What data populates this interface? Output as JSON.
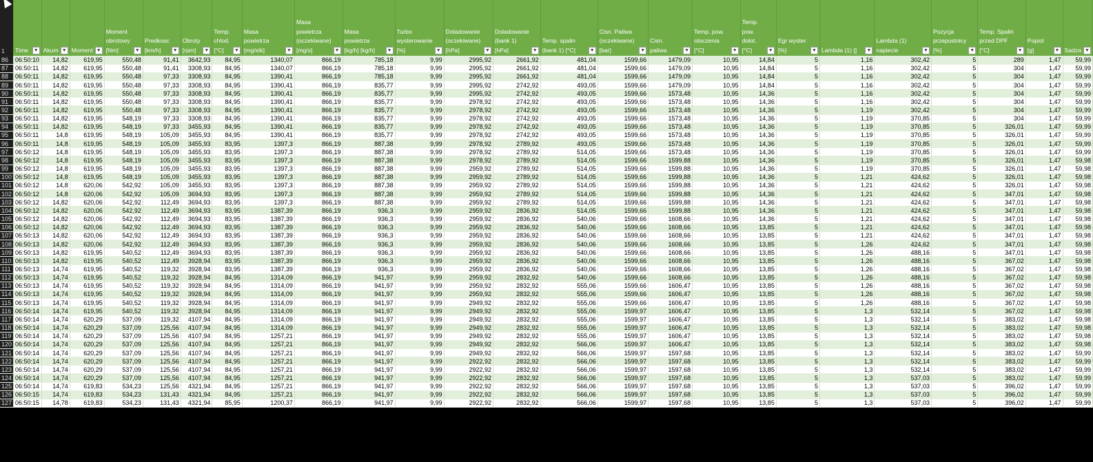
{
  "header_row_number": "1",
  "columns": [
    {
      "label": "Time",
      "w": 41
    },
    {
      "label": "Akum",
      "w": 30
    },
    {
      "label": "Moment",
      "w": 44
    },
    {
      "label": "Moment obrotowy [Nm]",
      "w": 57
    },
    {
      "label": "Predkosc [km/h]",
      "w": 54
    },
    {
      "label": "Obroty [rpm]",
      "w": 46
    },
    {
      "label": "Temp. chlod. [°C]",
      "w": 44
    },
    {
      "label": "Masa powietrza [mg/stk]",
      "w": 84
    },
    {
      "label": "Masa powietrza (oczekiwane) [mg/s]",
      "w": 42
    },
    {
      "label": "Masa powietrza [kg/h] [kg/h]",
      "w": 84
    },
    {
      "label": "Turbo wysterowanie [%]",
      "w": 45
    },
    {
      "label": "Doladowanie (oczekiwane) [hPa]",
      "w": 72
    },
    {
      "label": "Doladowanie (bank 1) [hPa]",
      "w": 44
    },
    {
      "label": "Temp. spalin (bank 1) [°C]",
      "w": 99
    },
    {
      "label": "Cisn. Paliwa (oczekiwane) [bar]",
      "w": 75
    },
    {
      "label": "Cisn. paliwa",
      "w": 72
    },
    {
      "label": "Temp. pow. otoczenia [°C]",
      "w": 75
    },
    {
      "label": "Temp. pow. dolot. [°C]",
      "w": 56
    },
    {
      "label": "Egr wyster. [%]",
      "w": 70
    },
    {
      "label": "Lambda (1) []",
      "w": 91
    },
    {
      "label": "Lambda (1) napiecie",
      "w": 95
    },
    {
      "label": "Pozycja przepustnicy [%]",
      "w": 43
    },
    {
      "label": "Temp. Spalin przed DPF [°C]",
      "w": 80
    },
    {
      "label": "Popiol [g]",
      "w": 58
    },
    {
      "label": "Sadza",
      "w": 36
    }
  ],
  "rows": [
    [
      "86",
      "06:50:10",
      "14,82",
      "619,95",
      "550,48",
      "91,41",
      "3642,93",
      "84,95",
      "1340,07",
      "866,19",
      "785,18",
      "9,99",
      "2995,92",
      "2661,92",
      "481,04",
      "1599,66",
      "1479,09",
      "10,95",
      "14,84",
      "5",
      "1,16",
      "302,42",
      "5",
      "289",
      "1,47",
      "59,99"
    ],
    [
      "87",
      "06:50:11",
      "14,82",
      "619,95",
      "550,48",
      "91,41",
      "3308,93",
      "84,95",
      "1340,07",
      "866,19",
      "785,18",
      "9,99",
      "2995,92",
      "2661,92",
      "481,04",
      "1599,66",
      "1479,09",
      "10,95",
      "14,84",
      "5",
      "1,16",
      "302,42",
      "5",
      "304",
      "1,47",
      "59,99"
    ],
    [
      "88",
      "06:50:11",
      "14,82",
      "619,95",
      "550,48",
      "97,33",
      "3308,93",
      "84,95",
      "1390,41",
      "866,19",
      "785,18",
      "9,99",
      "2995,92",
      "2661,92",
      "481,04",
      "1599,66",
      "1479,09",
      "10,95",
      "14,84",
      "5",
      "1,16",
      "302,42",
      "5",
      "304",
      "1,47",
      "59,99"
    ],
    [
      "89",
      "06:50:11",
      "14,82",
      "619,95",
      "550,48",
      "97,33",
      "3308,93",
      "84,95",
      "1390,41",
      "866,19",
      "835,77",
      "9,99",
      "2995,92",
      "2742,92",
      "493,05",
      "1599,66",
      "1479,09",
      "10,95",
      "14,84",
      "5",
      "1,16",
      "302,42",
      "5",
      "304",
      "1,47",
      "59,99"
    ],
    [
      "90",
      "06:50:11",
      "14,82",
      "619,95",
      "550,48",
      "97,33",
      "3308,93",
      "84,95",
      "1390,41",
      "866,19",
      "835,77",
      "9,99",
      "2995,92",
      "2742,92",
      "493,05",
      "1599,66",
      "1573,48",
      "10,95",
      "14,36",
      "5",
      "1,16",
      "302,42",
      "5",
      "304",
      "1,47",
      "59,99"
    ],
    [
      "91",
      "06:50:11",
      "14,82",
      "619,95",
      "550,48",
      "97,33",
      "3308,93",
      "84,95",
      "1390,41",
      "866,19",
      "835,77",
      "9,99",
      "2978,92",
      "2742,92",
      "493,05",
      "1599,66",
      "1573,48",
      "10,95",
      "14,36",
      "5",
      "1,16",
      "302,42",
      "5",
      "304",
      "1,47",
      "59,99"
    ],
    [
      "92",
      "06:50:11",
      "14,82",
      "619,95",
      "550,48",
      "97,33",
      "3308,93",
      "84,95",
      "1390,41",
      "866,19",
      "835,77",
      "9,99",
      "2978,92",
      "2742,92",
      "493,05",
      "1599,66",
      "1573,48",
      "10,95",
      "14,36",
      "5",
      "1,19",
      "302,42",
      "5",
      "304",
      "1,47",
      "59,99"
    ],
    [
      "93",
      "06:50:11",
      "14,82",
      "619,95",
      "548,19",
      "97,33",
      "3308,93",
      "84,95",
      "1390,41",
      "866,19",
      "835,77",
      "9,99",
      "2978,92",
      "2742,92",
      "493,05",
      "1599,66",
      "1573,48",
      "10,95",
      "14,36",
      "5",
      "1,19",
      "370,85",
      "5",
      "304",
      "1,47",
      "59,99"
    ],
    [
      "94",
      "06:50:11",
      "14,82",
      "619,95",
      "548,19",
      "97,33",
      "3455,93",
      "84,95",
      "1390,41",
      "866,19",
      "835,77",
      "9,99",
      "2978,92",
      "2742,92",
      "493,05",
      "1599,66",
      "1573,48",
      "10,95",
      "14,36",
      "5",
      "1,19",
      "370,85",
      "5",
      "326,01",
      "1,47",
      "59,99"
    ],
    [
      "95",
      "06:50:11",
      "14,8",
      "619,95",
      "548,19",
      "105,09",
      "3455,93",
      "84,95",
      "1390,41",
      "866,19",
      "835,77",
      "9,99",
      "2978,92",
      "2742,92",
      "493,05",
      "1599,66",
      "1573,48",
      "10,95",
      "14,36",
      "5",
      "1,19",
      "370,85",
      "5",
      "326,01",
      "1,47",
      "59,99"
    ],
    [
      "96",
      "06:50:11",
      "14,8",
      "619,95",
      "548,19",
      "105,09",
      "3455,93",
      "83,95",
      "1397,3",
      "866,19",
      "887,38",
      "9,99",
      "2978,92",
      "2789,92",
      "493,05",
      "1599,66",
      "1573,48",
      "10,95",
      "14,36",
      "5",
      "1,19",
      "370,85",
      "5",
      "326,01",
      "1,47",
      "59,99"
    ],
    [
      "97",
      "06:50:12",
      "14,8",
      "619,95",
      "548,19",
      "105,09",
      "3455,93",
      "83,95",
      "1397,3",
      "866,19",
      "887,38",
      "9,99",
      "2978,92",
      "2789,92",
      "514,05",
      "1599,66",
      "1573,48",
      "10,95",
      "14,36",
      "5",
      "1,19",
      "370,85",
      "5",
      "326,01",
      "1,47",
      "59,99"
    ],
    [
      "98",
      "06:50:12",
      "14,8",
      "619,95",
      "548,19",
      "105,09",
      "3455,93",
      "83,95",
      "1397,3",
      "866,19",
      "887,38",
      "9,99",
      "2978,92",
      "2789,92",
      "514,05",
      "1599,66",
      "1599,88",
      "10,95",
      "14,36",
      "5",
      "1,19",
      "370,85",
      "5",
      "326,01",
      "1,47",
      "59,98"
    ],
    [
      "99",
      "06:50:12",
      "14,8",
      "619,95",
      "548,19",
      "105,09",
      "3455,93",
      "83,95",
      "1397,3",
      "866,19",
      "887,38",
      "9,99",
      "2959,92",
      "2789,92",
      "514,05",
      "1599,66",
      "1599,88",
      "10,95",
      "14,36",
      "5",
      "1,19",
      "370,85",
      "5",
      "326,01",
      "1,47",
      "59,98"
    ],
    [
      "100",
      "06:50:12",
      "14,8",
      "619,95",
      "548,19",
      "105,09",
      "3455,93",
      "83,95",
      "1397,3",
      "866,19",
      "887,38",
      "9,99",
      "2959,92",
      "2789,92",
      "514,05",
      "1599,66",
      "1599,88",
      "10,95",
      "14,36",
      "5",
      "1,21",
      "424,62",
      "5",
      "326,01",
      "1,47",
      "59,98"
    ],
    [
      "101",
      "06:50:12",
      "14,8",
      "620,06",
      "542,92",
      "105,09",
      "3455,93",
      "83,95",
      "1397,3",
      "866,19",
      "887,38",
      "9,99",
      "2959,92",
      "2789,92",
      "514,05",
      "1599,66",
      "1599,88",
      "10,95",
      "14,36",
      "5",
      "1,21",
      "424,62",
      "5",
      "326,01",
      "1,47",
      "59,98"
    ],
    [
      "102",
      "06:50:12",
      "14,8",
      "620,06",
      "542,92",
      "105,09",
      "3694,93",
      "83,95",
      "1397,3",
      "866,19",
      "887,38",
      "9,99",
      "2959,92",
      "2789,92",
      "514,05",
      "1599,66",
      "1599,88",
      "10,95",
      "14,36",
      "5",
      "1,21",
      "424,62",
      "5",
      "347,01",
      "1,47",
      "59,98"
    ],
    [
      "103",
      "06:50:12",
      "14,82",
      "620,06",
      "542,92",
      "112,49",
      "3694,93",
      "83,95",
      "1397,3",
      "866,19",
      "887,38",
      "9,99",
      "2959,92",
      "2789,92",
      "514,05",
      "1599,66",
      "1599,88",
      "10,95",
      "14,36",
      "5",
      "1,21",
      "424,62",
      "5",
      "347,01",
      "1,47",
      "59,98"
    ],
    [
      "104",
      "06:50:12",
      "14,82",
      "620,06",
      "542,92",
      "112,49",
      "3694,93",
      "83,95",
      "1387,39",
      "866,19",
      "936,3",
      "9,99",
      "2959,92",
      "2836,92",
      "514,05",
      "1599,66",
      "1599,88",
      "10,95",
      "14,36",
      "5",
      "1,21",
      "424,62",
      "5",
      "347,01",
      "1,47",
      "59,98"
    ],
    [
      "105",
      "06:50:12",
      "14,82",
      "620,06",
      "542,92",
      "112,49",
      "3694,93",
      "83,95",
      "1387,39",
      "866,19",
      "936,3",
      "9,99",
      "2959,92",
      "2836,92",
      "540,06",
      "1599,66",
      "1608,66",
      "10,95",
      "14,36",
      "5",
      "1,21",
      "424,62",
      "5",
      "347,01",
      "1,47",
      "59,98"
    ],
    [
      "106",
      "06:50:12",
      "14,82",
      "620,06",
      "542,92",
      "112,49",
      "3694,93",
      "83,95",
      "1387,39",
      "866,19",
      "936,3",
      "9,99",
      "2959,92",
      "2836,92",
      "540,06",
      "1599,66",
      "1608,66",
      "10,95",
      "13,85",
      "5",
      "1,21",
      "424,62",
      "5",
      "347,01",
      "1,47",
      "59,98"
    ],
    [
      "107",
      "06:50:13",
      "14,82",
      "620,06",
      "542,92",
      "112,49",
      "3694,93",
      "83,95",
      "1387,39",
      "866,19",
      "936,3",
      "9,99",
      "2959,92",
      "2836,92",
      "540,06",
      "1599,66",
      "1608,66",
      "10,95",
      "13,85",
      "5",
      "1,21",
      "424,62",
      "5",
      "347,01",
      "1,47",
      "59,98"
    ],
    [
      "108",
      "06:50:13",
      "14,82",
      "620,06",
      "542,92",
      "112,49",
      "3694,93",
      "83,95",
      "1387,39",
      "866,19",
      "936,3",
      "9,99",
      "2959,92",
      "2836,92",
      "540,06",
      "1599,66",
      "1608,66",
      "10,95",
      "13,85",
      "5",
      "1,26",
      "424,62",
      "5",
      "347,01",
      "1,47",
      "59,98"
    ],
    [
      "109",
      "06:50:13",
      "14,82",
      "619,95",
      "540,52",
      "112,49",
      "3694,93",
      "83,95",
      "1387,39",
      "866,19",
      "936,3",
      "9,99",
      "2959,92",
      "2836,92",
      "540,06",
      "1599,66",
      "1608,66",
      "10,95",
      "13,85",
      "5",
      "1,26",
      "488,16",
      "5",
      "347,01",
      "1,47",
      "59,98"
    ],
    [
      "110",
      "06:50:13",
      "14,82",
      "619,95",
      "540,52",
      "112,49",
      "3928,94",
      "83,95",
      "1387,39",
      "866,19",
      "936,3",
      "9,99",
      "2959,92",
      "2836,92",
      "540,06",
      "1599,66",
      "1608,66",
      "10,95",
      "13,85",
      "5",
      "1,26",
      "488,16",
      "5",
      "367,02",
      "1,47",
      "59,98"
    ],
    [
      "111",
      "06:50:13",
      "14,74",
      "619,95",
      "540,52",
      "119,32",
      "3928,94",
      "83,95",
      "1387,39",
      "866,19",
      "936,3",
      "9,99",
      "2959,92",
      "2836,92",
      "540,06",
      "1599,66",
      "1608,66",
      "10,95",
      "13,85",
      "5",
      "1,26",
      "488,16",
      "5",
      "367,02",
      "1,47",
      "59,98"
    ],
    [
      "112",
      "06:50:13",
      "14,74",
      "619,95",
      "540,52",
      "119,32",
      "3928,94",
      "84,95",
      "1314,09",
      "866,19",
      "941,97",
      "9,99",
      "2959,92",
      "2832,92",
      "540,06",
      "1599,66",
      "1608,66",
      "10,95",
      "13,85",
      "5",
      "1,26",
      "488,16",
      "5",
      "367,02",
      "1,47",
      "59,98"
    ],
    [
      "113",
      "06:50:13",
      "14,74",
      "619,95",
      "540,52",
      "119,32",
      "3928,94",
      "84,95",
      "1314,09",
      "866,19",
      "941,97",
      "9,99",
      "2959,92",
      "2832,92",
      "555,06",
      "1599,66",
      "1606,47",
      "10,95",
      "13,85",
      "5",
      "1,26",
      "488,16",
      "5",
      "367,02",
      "1,47",
      "59,98"
    ],
    [
      "114",
      "06:50:13",
      "14,74",
      "619,95",
      "540,52",
      "119,32",
      "3928,94",
      "84,95",
      "1314,09",
      "866,19",
      "941,97",
      "9,99",
      "2959,92",
      "2832,92",
      "555,06",
      "1599,66",
      "1606,47",
      "10,95",
      "13,85",
      "5",
      "1,26",
      "488,16",
      "5",
      "367,02",
      "1,47",
      "59,98"
    ],
    [
      "115",
      "06:50:13",
      "14,74",
      "619,95",
      "540,52",
      "119,32",
      "3928,94",
      "84,95",
      "1314,09",
      "866,19",
      "941,97",
      "9,99",
      "2949,92",
      "2832,92",
      "555,06",
      "1599,66",
      "1606,47",
      "10,95",
      "13,85",
      "5",
      "1,26",
      "488,16",
      "5",
      "367,02",
      "1,47",
      "59,98"
    ],
    [
      "116",
      "06:50:14",
      "14,74",
      "619,95",
      "540,52",
      "119,32",
      "3928,94",
      "84,95",
      "1314,09",
      "866,19",
      "941,97",
      "9,99",
      "2949,92",
      "2832,92",
      "555,06",
      "1599,97",
      "1606,47",
      "10,95",
      "13,85",
      "5",
      "1,3",
      "532,14",
      "5",
      "367,02",
      "1,47",
      "59,98"
    ],
    [
      "117",
      "06:50:14",
      "14,74",
      "620,29",
      "537,09",
      "119,32",
      "4107,94",
      "84,95",
      "1314,09",
      "866,19",
      "941,97",
      "9,99",
      "2949,92",
      "2832,92",
      "555,06",
      "1599,97",
      "1606,47",
      "10,95",
      "13,85",
      "5",
      "1,3",
      "532,14",
      "5",
      "383,02",
      "1,47",
      "59,98"
    ],
    [
      "118",
      "06:50:14",
      "14,74",
      "620,29",
      "537,09",
      "125,56",
      "4107,94",
      "84,95",
      "1314,09",
      "866,19",
      "941,97",
      "9,99",
      "2949,92",
      "2832,92",
      "555,06",
      "1599,97",
      "1606,47",
      "10,95",
      "13,85",
      "5",
      "1,3",
      "532,14",
      "5",
      "383,02",
      "1,47",
      "59,98"
    ],
    [
      "119",
      "06:50:14",
      "14,74",
      "620,29",
      "537,09",
      "125,56",
      "4107,94",
      "84,95",
      "1257,21",
      "866,19",
      "941,97",
      "9,99",
      "2949,92",
      "2832,92",
      "555,06",
      "1599,97",
      "1606,47",
      "10,95",
      "13,85",
      "5",
      "1,3",
      "532,14",
      "5",
      "383,02",
      "1,47",
      "59,98"
    ],
    [
      "120",
      "06:50:14",
      "14,74",
      "620,29",
      "537,09",
      "125,56",
      "4107,94",
      "84,95",
      "1257,21",
      "866,19",
      "941,97",
      "9,99",
      "2949,92",
      "2832,92",
      "566,06",
      "1599,97",
      "1606,47",
      "10,95",
      "13,85",
      "5",
      "1,3",
      "532,14",
      "5",
      "383,02",
      "1,47",
      "59,98"
    ],
    [
      "121",
      "06:50:14",
      "14,74",
      "620,29",
      "537,09",
      "125,56",
      "4107,94",
      "84,95",
      "1257,21",
      "866,19",
      "941,97",
      "9,99",
      "2949,92",
      "2832,92",
      "566,06",
      "1599,97",
      "1597,68",
      "10,95",
      "13,85",
      "5",
      "1,3",
      "532,14",
      "5",
      "383,02",
      "1,47",
      "59,99"
    ],
    [
      "122",
      "06:50:14",
      "14,74",
      "620,29",
      "537,09",
      "125,56",
      "4107,94",
      "84,95",
      "1257,21",
      "866,19",
      "941,97",
      "9,99",
      "2922,92",
      "2832,92",
      "566,06",
      "1599,97",
      "1597,68",
      "10,95",
      "13,85",
      "5",
      "1,3",
      "532,14",
      "5",
      "383,02",
      "1,47",
      "59,99"
    ],
    [
      "123",
      "06:50:14",
      "14,74",
      "620,29",
      "537,09",
      "125,56",
      "4107,94",
      "84,95",
      "1257,21",
      "866,19",
      "941,97",
      "9,99",
      "2922,92",
      "2832,92",
      "566,06",
      "1599,97",
      "1597,68",
      "10,95",
      "13,85",
      "5",
      "1,3",
      "532,14",
      "5",
      "383,02",
      "1,47",
      "59,99"
    ],
    [
      "124",
      "06:50:14",
      "14,74",
      "620,29",
      "537,09",
      "125,56",
      "4107,94",
      "84,95",
      "1257,21",
      "866,19",
      "941,97",
      "9,99",
      "2922,92",
      "2832,92",
      "566,06",
      "1599,97",
      "1597,68",
      "10,95",
      "13,85",
      "5",
      "1,3",
      "537,03",
      "5",
      "383,02",
      "1,47",
      "59,99"
    ],
    [
      "125",
      "06:50:14",
      "14,74",
      "619,83",
      "534,23",
      "125,56",
      "4321,94",
      "84,95",
      "1257,21",
      "866,19",
      "941,97",
      "9,99",
      "2922,92",
      "2832,92",
      "566,06",
      "1599,97",
      "1597,68",
      "10,95",
      "13,85",
      "5",
      "1,3",
      "537,03",
      "5",
      "396,02",
      "1,47",
      "59,99"
    ],
    [
      "126",
      "06:50:15",
      "14,74",
      "619,83",
      "534,23",
      "131,43",
      "4321,94",
      "84,95",
      "1257,21",
      "866,19",
      "941,97",
      "9,99",
      "2922,92",
      "2832,92",
      "566,06",
      "1599,97",
      "1597,68",
      "10,95",
      "13,85",
      "5",
      "1,3",
      "537,03",
      "5",
      "396,02",
      "1,47",
      "59,99"
    ],
    [
      "127",
      "06:50:15",
      "14,78",
      "619,83",
      "534,23",
      "131,43",
      "4321,94",
      "85,95",
      "1200,37",
      "866,19",
      "941,97",
      "9,99",
      "2922,92",
      "2832,92",
      "566,06",
      "1599,97",
      "1597,68",
      "10,95",
      "13,85",
      "5",
      "1,3",
      "537,03",
      "5",
      "396,02",
      "1,47",
      "59,99"
    ]
  ],
  "colors": {
    "header_bg": "#70ad47",
    "band": "#e2efda",
    "rownum_bg": "#1f1f1f"
  },
  "icons": {
    "filter": "filter-dropdown-icon",
    "cursor": "mouse-pointer-icon"
  }
}
